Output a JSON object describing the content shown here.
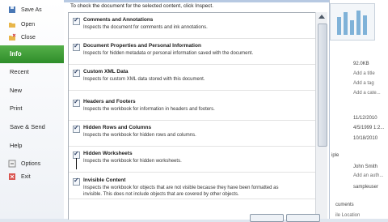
{
  "sidebar": {
    "items": [
      {
        "label": "Save As",
        "icon": "save-as-icon"
      },
      {
        "label": "Open",
        "icon": "open-folder-icon"
      },
      {
        "label": "Close",
        "icon": "close-file-icon"
      }
    ],
    "active": "Info",
    "sections": [
      "Recent",
      "New",
      "Print",
      "Save & Send",
      "Help"
    ],
    "footer": [
      {
        "label": "Options",
        "icon": "options-icon"
      },
      {
        "label": "Exit",
        "icon": "exit-icon"
      }
    ]
  },
  "dialog": {
    "intro": "To check the document for the selected content, click Inspect.",
    "items": [
      {
        "title": "Comments and Annotations",
        "desc": [
          "Inspects the document for comments and ink annotations."
        ],
        "checked": true
      },
      {
        "title": "Document Properties and Personal Information",
        "desc": [
          "Inspects for hidden metadata or personal information saved with the document."
        ],
        "checked": true
      },
      {
        "title": "Custom XML Data",
        "desc": [
          "Inspects for custom XML data stored with this document."
        ],
        "checked": true
      },
      {
        "title": "Headers and Footers",
        "desc": [
          "Inspects the workbook for information in headers and footers."
        ],
        "checked": true
      },
      {
        "title": "Hidden Rows and Columns",
        "desc": [
          "Inspects the workbook for hidden rows and columns."
        ],
        "checked": true
      },
      {
        "title": "Hidden Worksheets",
        "desc": [
          "Inspects the workbook for hidden worksheets."
        ],
        "checked": true
      },
      {
        "title": "Invisible Content",
        "desc": [
          "Inspects the workbook for objects that are not visible because they have been formatted as",
          "invisible. This does not include objects that are covered by other objects."
        ],
        "checked": true
      }
    ]
  },
  "background": {
    "size": "92.0KB",
    "add_title": "Add a title",
    "add_tag": "Add a tag",
    "add_category": "Add a cate...",
    "date1": "11/12/2010",
    "date2": "4/5/1999 1:2...",
    "date3": "10/18/2010",
    "people_label": "iple",
    "author": "John Smith",
    "add_author": "Add an auth...",
    "modified_by": "sampleuser",
    "related": "cuments",
    "location": "ile Location"
  }
}
